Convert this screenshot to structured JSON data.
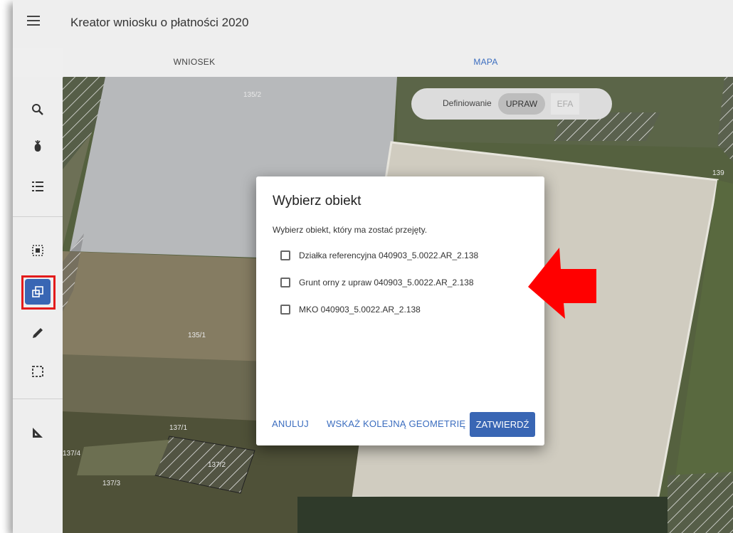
{
  "header": {
    "title": "Kreator wniosku o płatności 2020"
  },
  "tabs": [
    {
      "label": "WNIOSEK"
    },
    {
      "label": "MAPA"
    }
  ],
  "map": {
    "toggle": {
      "label": "Definiowanie",
      "options": [
        "UPRAW",
        "EFA"
      ],
      "selected": "UPRAW"
    },
    "parcels": [
      "135/2",
      "139",
      "135/1",
      "137/1",
      "137/4",
      "137/2",
      "137/3"
    ]
  },
  "dialog": {
    "title": "Wybierz obiekt",
    "subtitle": "Wybierz obiekt, który ma zostać przejęty.",
    "options": [
      {
        "label": "Działka referencyjna 040903_5.0022.AR_2.138",
        "checked": false
      },
      {
        "label": "Grunt orny z upraw 040903_5.0022.AR_2.138",
        "checked": false
      },
      {
        "label": "MKO 040903_5.0022.AR_2.138",
        "checked": false
      }
    ],
    "buttons": {
      "cancel": "ANULUJ",
      "next_geometry": "WSKAŻ KOLEJNĄ GEOMETRIĘ",
      "confirm": "ZATWIERDŹ"
    }
  },
  "sidebar": {
    "tools": [
      "search-icon",
      "crop-icon",
      "list-icon",
      "select-area-icon",
      "copy-geometry-icon",
      "pencil-icon",
      "rectangle-select-icon",
      "measure-icon"
    ],
    "active_tool": "copy-geometry-icon"
  },
  "colors": {
    "accent": "#3966b4",
    "highlight": "#e31b1b",
    "arrow": "#ff0000"
  }
}
